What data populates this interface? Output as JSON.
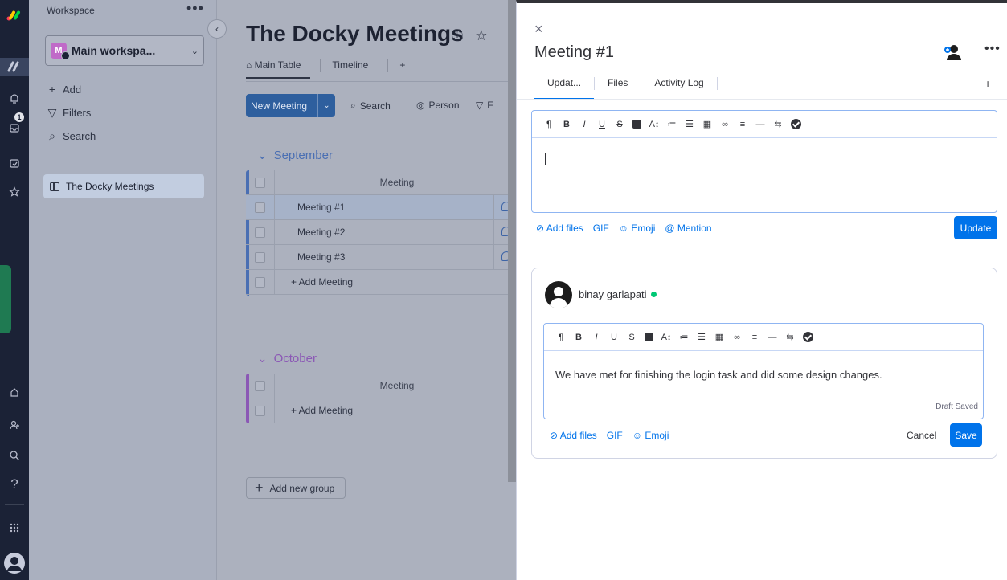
{
  "rail": {
    "badge_count": "1"
  },
  "workspace": {
    "label": "Workspace",
    "more": "•••",
    "collapse": "‹",
    "avatar_letter": "M",
    "name": "Main workspa...",
    "actions": [
      {
        "icon": "+",
        "label": "Add"
      },
      {
        "icon": "▽",
        "label": "Filters"
      },
      {
        "icon": "⌕",
        "label": "Search"
      }
    ],
    "board_item": "The Docky Meetings"
  },
  "board": {
    "title": "The Docky Meetings",
    "title_icons": "ⓘ ☆",
    "tabs": [
      {
        "label": "⌂ Main Table"
      },
      {
        "label": "Timeline"
      },
      {
        "label": "+"
      }
    ],
    "new_button": "New Meeting",
    "new_caret": "⌄",
    "tools": [
      {
        "icon": "⌕",
        "label": "Search"
      },
      {
        "icon": "◎",
        "label": "Person"
      },
      {
        "icon": "▽",
        "label": "F"
      }
    ],
    "groups": [
      {
        "title": "September",
        "chevron": "⌄",
        "column_header": "Meeting",
        "rows": [
          "Meeting #1",
          "Meeting #2",
          "Meeting #3"
        ],
        "add_label": "+ Add Meeting"
      },
      {
        "title": "October",
        "chevron": "⌄",
        "column_header": "Meeting",
        "rows": [],
        "add_label": "+ Add Meeting"
      }
    ],
    "add_group": {
      "icon": "+",
      "label": "Add new group"
    }
  },
  "panel": {
    "close": "×",
    "title": "Meeting #1",
    "more": "•••",
    "tabs": [
      "Updat...",
      "Files",
      "Activity Log"
    ],
    "tab_plus": "+",
    "toolbar": [
      "¶",
      "B",
      "I",
      "U",
      "S",
      "",
      "A↕",
      "≔",
      "☰",
      "▦",
      "∞",
      "≡",
      "—",
      "⇆",
      ""
    ],
    "composer": {
      "links": [
        "⊘ Add files",
        "GIF",
        "☺ Emoji",
        "@ Mention"
      ],
      "update_button": "Update"
    },
    "post": {
      "author": "binay garlapati",
      "text": "We have met for finishing the login task and did some design changes.",
      "draft_status": "Draft Saved",
      "links": [
        "⊘ Add files",
        "GIF",
        "☺ Emoji"
      ],
      "cancel": "Cancel",
      "save": "Save"
    }
  },
  "colors": {
    "accent": "#0073ea",
    "rail": "#1b2236",
    "group_september": "#4a6fb3",
    "group_october": "#8b58b5",
    "online": "#00c875"
  }
}
